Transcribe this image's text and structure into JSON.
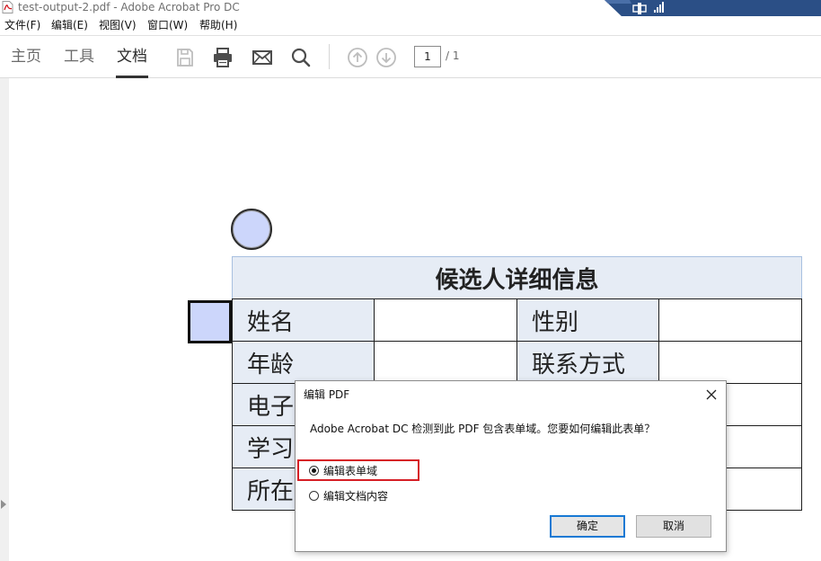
{
  "window": {
    "title": "test-output-2.pdf - Adobe Acrobat Pro DC"
  },
  "menu": [
    "文件(F)",
    "编辑(E)",
    "视图(V)",
    "窗口(W)",
    "帮助(H)"
  ],
  "toolbar": {
    "tabs": [
      "主页",
      "工具",
      "文档"
    ],
    "active_tab": "文档",
    "icons": [
      "save-icon",
      "print-icon",
      "email-icon",
      "search-icon",
      "page-up-icon",
      "page-down-icon"
    ],
    "page_number": "1",
    "page_total": "/ 1"
  },
  "form": {
    "header": "候选人详细信息",
    "rows": [
      [
        "姓名",
        "",
        "性别",
        ""
      ],
      [
        "年龄",
        "",
        "联系方式",
        ""
      ],
      [
        "电子",
        "",
        "",
        ""
      ],
      [
        "学习",
        "",
        "",
        ""
      ],
      [
        "所在",
        "",
        "",
        ""
      ]
    ]
  },
  "dialog": {
    "title": "编辑 PDF",
    "message": "Adobe Acrobat DC 检测到此 PDF 包含表单域。您要如何编辑此表单？",
    "options": [
      {
        "label": "编辑表单域",
        "selected": true
      },
      {
        "label": "编辑文档内容",
        "selected": false
      }
    ],
    "ok_label": "确定",
    "cancel_label": "取消",
    "highlight_color": "#d61f26",
    "ok_border_color": "#1779d4"
  },
  "colors": {
    "field_fill": "#ccd6fb",
    "label_cell_fill": "#e6ecf5",
    "taskbar_blue": "#2b4f86"
  }
}
